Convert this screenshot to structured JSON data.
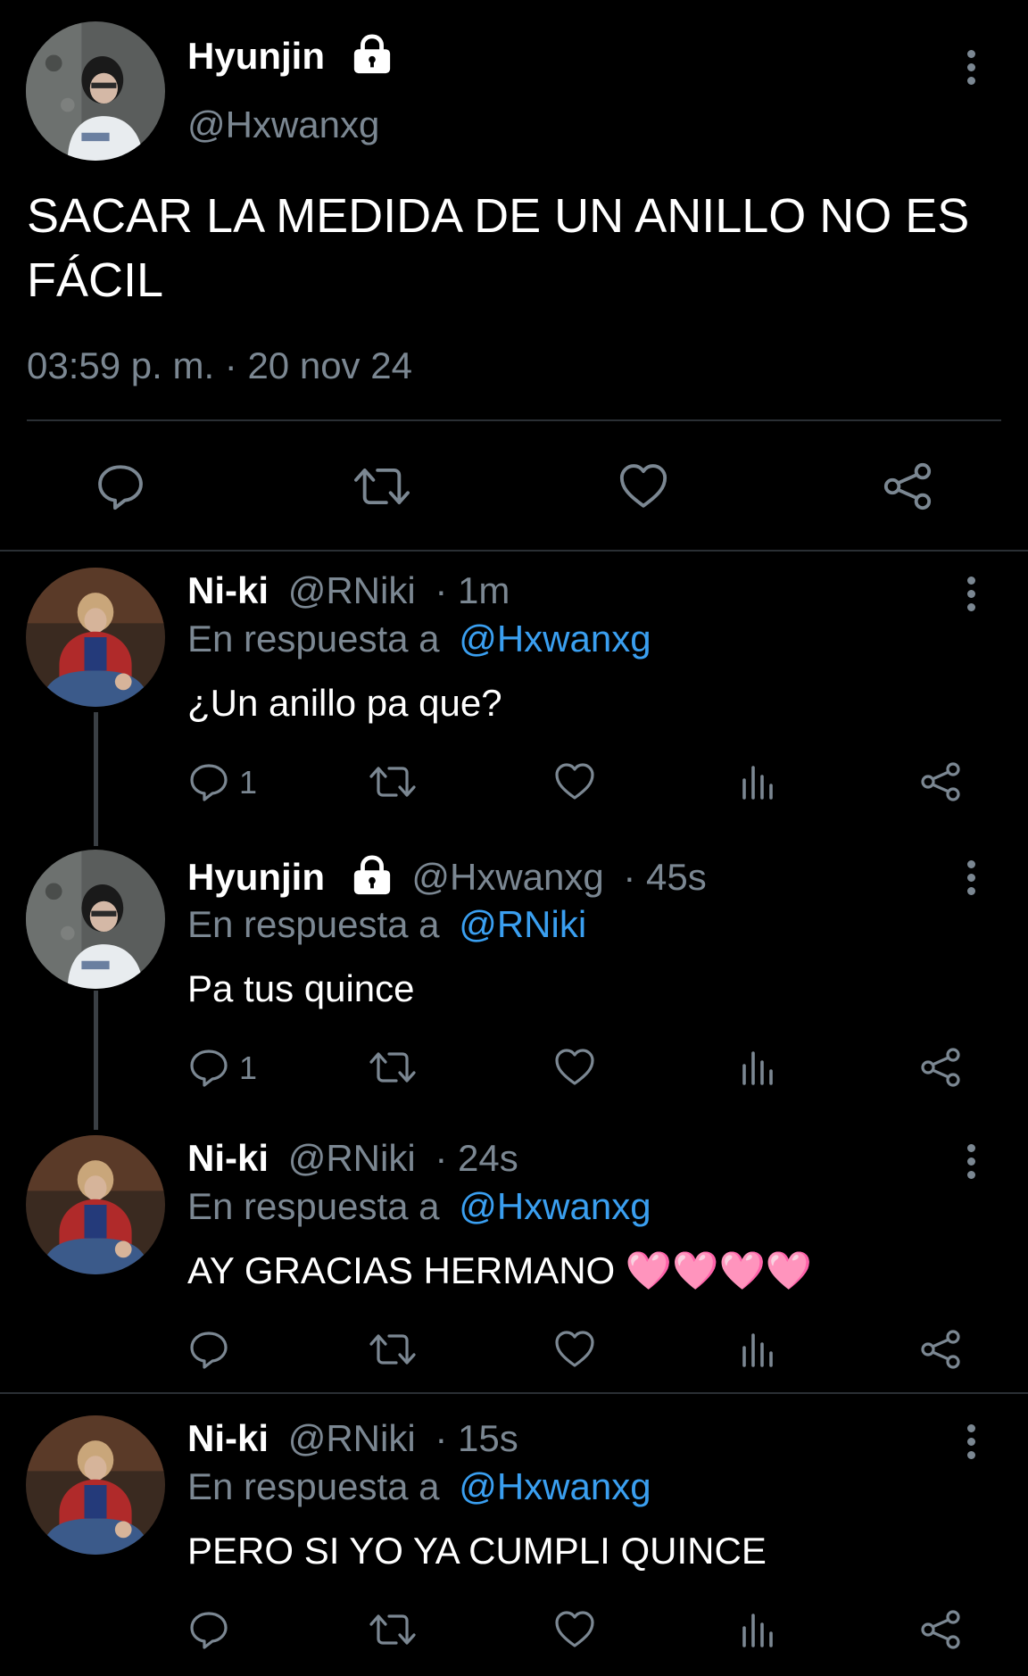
{
  "main_tweet": {
    "author_name": "Hyunjin",
    "handle": "@Hxwanxg",
    "text": "SACAR LA MEDIDA DE UN ANILLO NO ES FÁCIL",
    "timestamp": "03:59 p. m. · 20 nov 24"
  },
  "replies": [
    {
      "author_name": "Ni-ki",
      "handle": "@RNiki",
      "time": "· 1m",
      "reply_prefix": "En respuesta a",
      "reply_to": "@Hxwanxg",
      "text": "¿Un anillo pa que?",
      "reply_count": "1"
    },
    {
      "author_name": "Hyunjin",
      "handle": "@Hxwanxg",
      "time": "· 45s",
      "reply_prefix": "En respuesta a",
      "reply_to": "@RNiki",
      "text": "Pa tus quince",
      "reply_count": "1"
    },
    {
      "author_name": "Ni-ki",
      "handle": "@RNiki",
      "time": "· 24s",
      "reply_prefix": "En respuesta a",
      "reply_to": "@Hxwanxg",
      "text": "AY GRACIAS HERMANO 🩷🩷🩷🩷",
      "reply_count": ""
    },
    {
      "author_name": "Ni-ki",
      "handle": "@RNiki",
      "time": "· 15s",
      "reply_prefix": "En respuesta a",
      "reply_to": "@Hxwanxg",
      "text": "PERO SI YO YA CUMPLI QUINCE",
      "reply_count": ""
    }
  ],
  "icons": {
    "protected": "lock-icon",
    "reply": "reply-icon",
    "retweet": "retweet-icon",
    "like": "heart-icon",
    "views": "views-icon",
    "share": "share-icon",
    "more": "more-vertical-icon"
  },
  "colors": {
    "background": "#000000",
    "text": "#ffffff",
    "secondary": "#7b8792",
    "link": "#3a9ff0"
  }
}
